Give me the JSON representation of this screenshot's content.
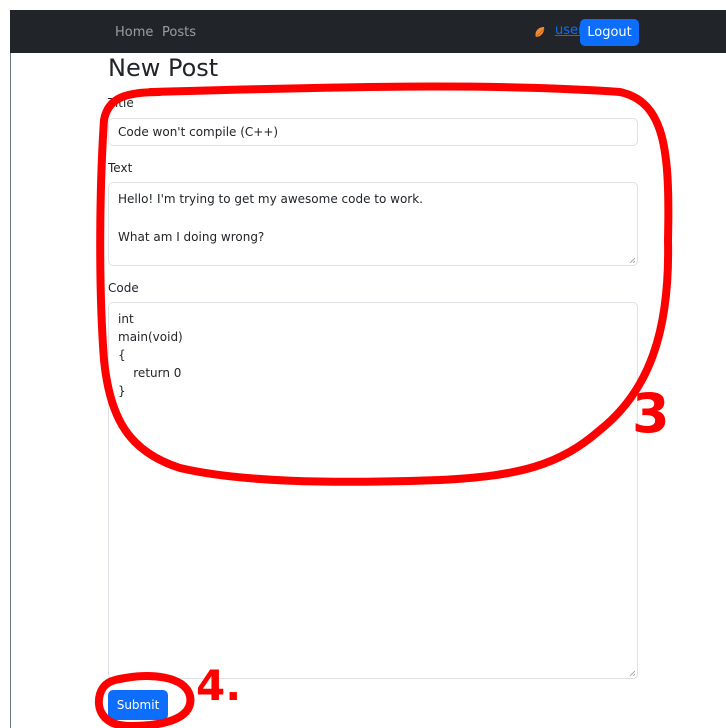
{
  "navbar": {
    "links": [
      "Home",
      "Posts"
    ],
    "user_link": "user",
    "logout_label": "Logout"
  },
  "page": {
    "title": "New Post"
  },
  "form": {
    "title_label": "Title",
    "title_value": "Code won't compile (C++)",
    "text_label": "Text",
    "text_value": "Hello! I'm trying to get my awesome code to work.\n\nWhat am I doing wrong?",
    "code_label": "Code",
    "code_value": "int\nmain(void)\n{\n    return 0\n}",
    "submit_label": "Submit"
  },
  "annotations": {
    "marker_3": "3",
    "marker_4": "4.",
    "color": "#ff0000"
  },
  "colors": {
    "navbar_bg": "#212529",
    "primary": "#0d6efd",
    "user_icon": "#f08c2e"
  },
  "icons": {
    "user": "leaf-user-icon"
  }
}
